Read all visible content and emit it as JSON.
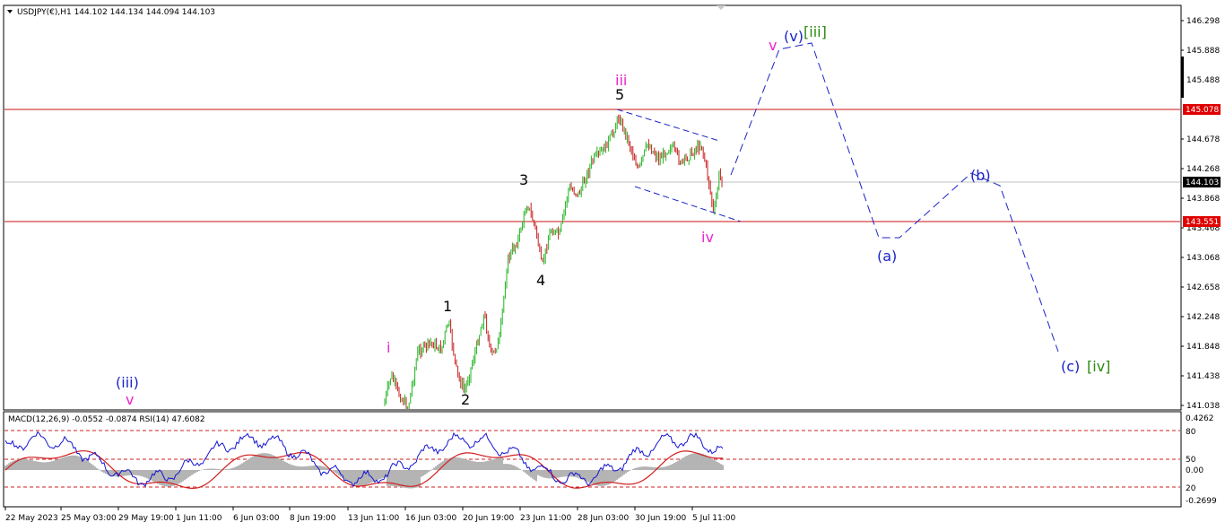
{
  "header": {
    "symbol_line": "USDJPY(€),H1  144.102 144.134 144.094 144.103"
  },
  "indicator": {
    "label": "MACD(12,26,9) -0.0552 -0.0874  RSI(14) 47.6082"
  },
  "price_axis": {
    "ticks": [
      "146.298",
      "145.888",
      "145.488",
      "144.678",
      "144.268",
      "143.868",
      "143.468",
      "143.068",
      "142.658",
      "142.248",
      "141.848",
      "141.438",
      "141.038"
    ],
    "current": "144.103",
    "level_high": "145.078",
    "level_low": "143.551"
  },
  "indicator_axis": {
    "ticks": [
      "0.4262",
      "80",
      "50",
      "0.00",
      "20",
      "-0.2699"
    ]
  },
  "time_axis": {
    "ticks": [
      "22 May 2023",
      "25 May 03:00",
      "29 May 19:00",
      "1 Jun 11:00",
      "6 Jun 03:00",
      "8 Jun 19:00",
      "13 Jun 11:00",
      "16 Jun 03:00",
      "20 Jun 19:00",
      "23 Jun 11:00",
      "28 Jun 03:00",
      "30 Jun 19:00",
      "5 Jul 11:00"
    ]
  },
  "wave_labels": {
    "iii_pink": "iii",
    "five": "5",
    "v_pink": "v",
    "v_blue": "(v)",
    "iii_green": "[iii]",
    "three": "3",
    "iv_pink": "iv",
    "four": "4",
    "one": "1",
    "i_pink": "i",
    "two": "2",
    "iii_blue_left": "(iii)",
    "v_pink_left": "v",
    "a_blue": "(a)",
    "b_blue": "(b)",
    "c_blue": "(c)",
    "iv_green": "[iv]"
  },
  "colors": {
    "level_line": "#cc1111",
    "wave_pink": "#ee22cc",
    "wave_blue": "#1a23c8",
    "wave_green": "#2a8a10",
    "candle_up": "#22b422",
    "candle_down": "#c81e1e",
    "macd_hist": "#b4b4b4",
    "rsi_line": "#1414d2",
    "signal_line": "#d21e1e",
    "current_bg": "#000000",
    "level_bg": "#e00000"
  }
}
